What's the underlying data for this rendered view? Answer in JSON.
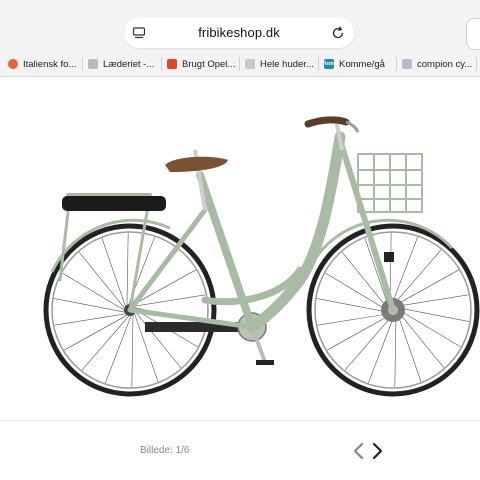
{
  "browser": {
    "url": "fribikeshop.dk",
    "tabs": [
      {
        "label": "Italiensk fo...",
        "icon": "orange-circle-favicon",
        "color": "#e8643a"
      },
      {
        "label": "Læderiet -...",
        "icon": "grey-page-favicon",
        "color": "#b9bcc8"
      },
      {
        "label": "Brugt Opel...",
        "icon": "red-square-favicon",
        "color": "#d94a2b"
      },
      {
        "label": "Hele huder...",
        "icon": "grey-page-favicon",
        "color": "#c8cad2"
      },
      {
        "label": "Komme/gå",
        "icon": "teal-square-favicon",
        "color": "#1f8f9a",
        "icon_text": "Visma"
      },
      {
        "label": "compion cy...",
        "icon": "grey-page-favicon",
        "color": "#b9bcc8"
      }
    ]
  },
  "product": {
    "image": "mint-green-city-e-bike-photo",
    "frame_color": "#a9bba4",
    "gallery_caption": "Billede: 1/6"
  }
}
